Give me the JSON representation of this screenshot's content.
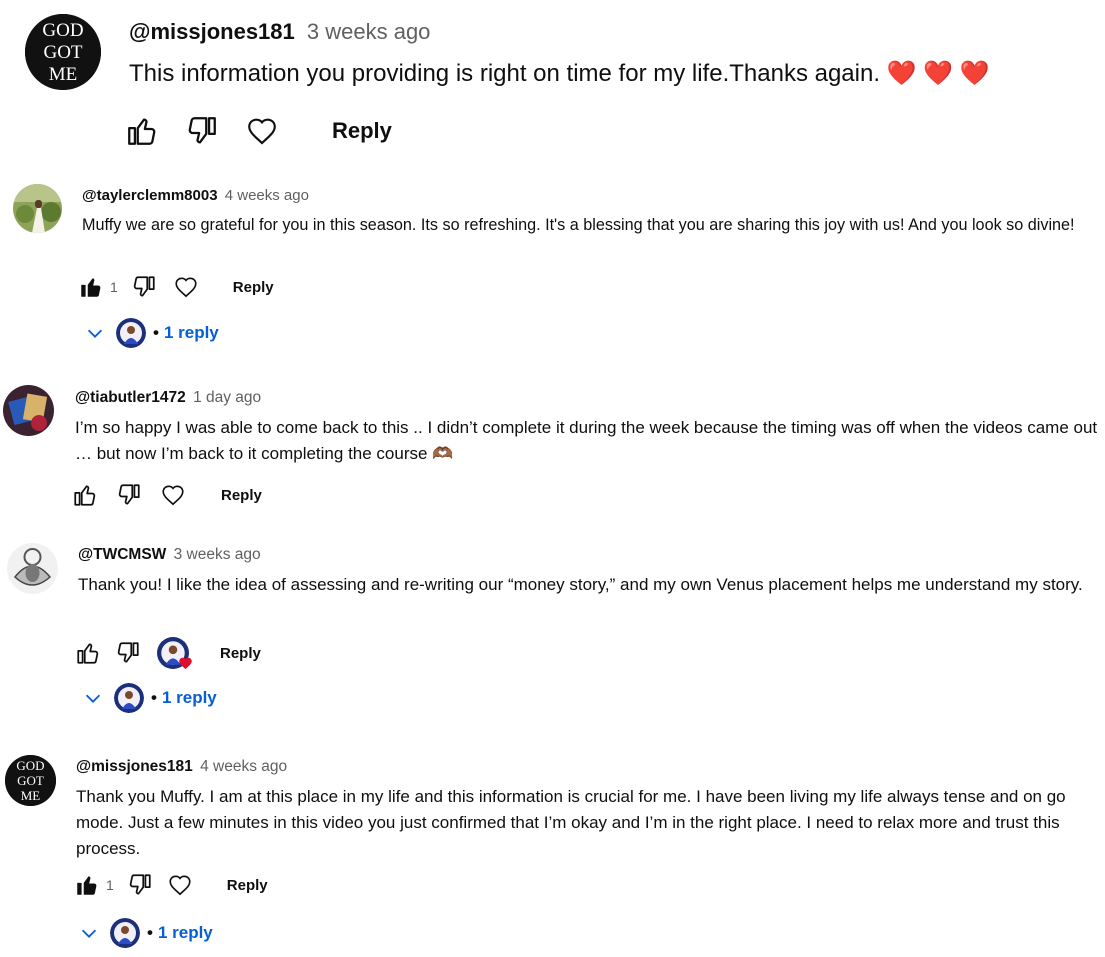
{
  "colors": {
    "link": "#065fd4",
    "muted": "#606060",
    "heart": "#e0102b",
    "text": "#0f0f0f"
  },
  "comments": [
    {
      "author": "@missjones181",
      "time": "3 weeks ago",
      "text": "This information you providing is right on time for my life.Thanks again.",
      "emoji": "❤️ ❤️ ❤️",
      "like_count": "",
      "reply_label": "Reply"
    },
    {
      "author": "@taylerclemm8003",
      "time": "4 weeks ago",
      "text": "Muffy we are so grateful for you in this season. Its so refreshing. It's a blessing that you are sharing this joy with us! And you look so divine!",
      "like_count": "1",
      "reply_label": "Reply",
      "replies_label": "1 reply"
    },
    {
      "author": "@tiabutler1472",
      "time": "1 day ago",
      "text": "I’m so happy I was able to come back to this .. I didn’t complete it during the week because the timing was off when the videos came out … but now I’m back to it completing the course",
      "emoji": "🫶🏾",
      "like_count": "",
      "reply_label": "Reply"
    },
    {
      "author": "@TWCMSW",
      "time": "3 weeks ago",
      "text": "Thank you! I like the idea of assessing and re-writing our “money story,” and my own Venus placement helps me understand my story.",
      "like_count": "",
      "reply_label": "Reply",
      "replies_label": "1 reply"
    },
    {
      "author": "@missjones181",
      "time": "4 weeks ago",
      "text": "Thank you Muffy. I am at this place in my life and this information is crucial for me. I have been living my life always tense and on go mode. Just a few minutes in this video you just confirmed that I’m okay and I’m in the right place. I need to relax more and trust this process.",
      "like_count": "1",
      "reply_label": "Reply",
      "replies_label": "1 reply"
    }
  ],
  "avatar_logo_text": [
    "GOD",
    "GOT",
    "ME"
  ],
  "icons": [
    "thumbs-up-icon",
    "thumbs-down-icon",
    "heart-icon",
    "chevron-down-icon"
  ]
}
